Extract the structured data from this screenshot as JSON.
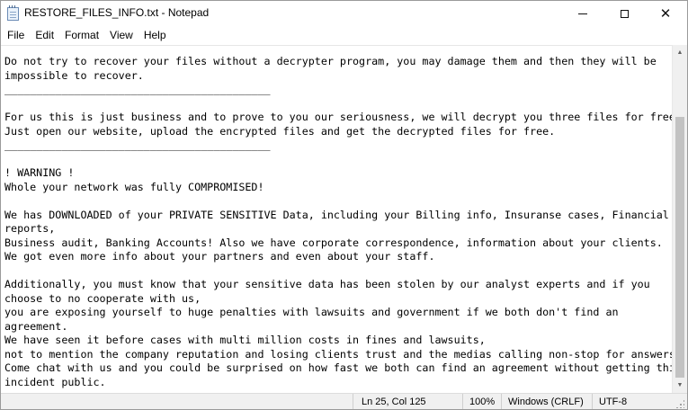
{
  "window": {
    "title": "RESTORE_FILES_INFO.txt - Notepad",
    "controls": {
      "minimize": "—",
      "maximize": "☐",
      "close": "✕"
    }
  },
  "menu": [
    "File",
    "Edit",
    "Format",
    "View",
    "Help"
  ],
  "document": {
    "lines": [
      "Do not try to recover your files without a decrypter program, you may damage them and then they will be",
      "impossible to recover.",
      "__________________________________________",
      "",
      "For us this is just business and to prove to you our seriousness, we will decrypt you three files for free.",
      "Just open our website, upload the encrypted files and get the decrypted files for free.",
      "__________________________________________",
      "",
      "! WARNING !",
      "Whole your network was fully COMPROMISED!",
      "",
      "We has DOWNLOADED of your PRIVATE SENSITIVE Data, including your Billing info, Insuranse cases, Financial",
      "reports,",
      "Business audit, Banking Accounts! Also we have corporate correspondence, information about your clients.",
      "We got even more info about your partners and even about your staff.",
      "",
      "Additionally, you must know that your sensitive data has been stolen by our analyst experts and if you",
      "choose to no cooperate with us,",
      "you are exposing yourself to huge penalties with lawsuits and government if we both don't find an",
      "agreement.",
      "We have seen it before cases with multi million costs in fines and lawsuits,",
      "not to mention the company reputation and losing clients trust and the medias calling non-stop for answers.",
      "Come chat with us and you could be surprised on how fast we both can find an agreement without getting this",
      "incident public."
    ]
  },
  "statusbar": {
    "position": "Ln 25, Col 125",
    "zoom": "100%",
    "line_ending": "Windows (CRLF)",
    "encoding": "UTF-8"
  },
  "scrollbar": {
    "up_arrow": "▲",
    "down_arrow": "▼"
  }
}
